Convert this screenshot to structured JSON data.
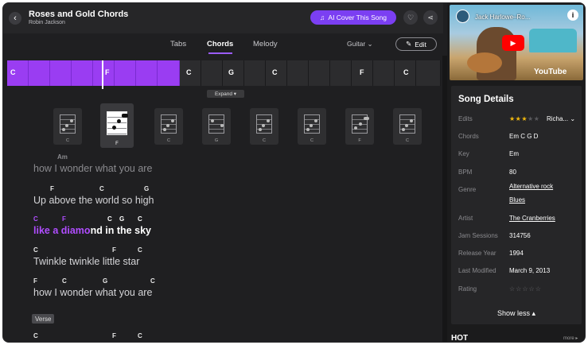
{
  "header": {
    "title": "Roses and Gold Chords",
    "artist": "Robin Jackson",
    "back_icon": "‹",
    "ai_cover_label": "AI Cover This Song",
    "ai_icon": "♫",
    "heart_icon": "♡",
    "share_icon": "⋖"
  },
  "tabs": {
    "tabs_label": "Tabs",
    "chords_label": "Chords",
    "melody_label": "Melody",
    "instrument": "Guitar",
    "instrument_caret": "⌄",
    "edit_label": "Edit",
    "edit_icon": "✎"
  },
  "timeline": {
    "chords": [
      "C",
      "F",
      "C",
      "G",
      "C",
      "F",
      "C"
    ],
    "expand_label": "Expand ▾"
  },
  "chord_diagrams": [
    "C",
    "F",
    "C",
    "G",
    "C",
    "C",
    "F",
    "C"
  ],
  "lyrics": [
    {
      "chords": [
        "Am"
      ],
      "text": "how I wonder what you are"
    },
    {
      "chords": [
        "F",
        "C",
        "G"
      ],
      "text": "Up above the world so high"
    },
    {
      "chords": [
        "C",
        "F",
        "C",
        "G",
        "C"
      ],
      "text_highlight": "like a diamo",
      "text_rest": "nd in the sky"
    },
    {
      "chords": [
        "C",
        "F",
        "C"
      ],
      "text": "Twinkle twinkle little star"
    },
    {
      "chords": [
        "F",
        "C",
        "G",
        "C"
      ],
      "text": "how I wonder what you are"
    },
    {
      "chords": [
        "C",
        "F",
        "C"
      ],
      "text": ""
    }
  ],
  "verse_tag": "Verse",
  "video": {
    "title": "Jack Harlowe–Ro...",
    "info_icon": "i",
    "play_icon": "▶",
    "logo": "YouTube"
  },
  "details": {
    "title": "Song Details",
    "edits_label": "Edits",
    "edits_value": "Richa...",
    "edits_caret": "⌄",
    "edits_rating": 3,
    "chords_label": "Chords",
    "chords_value": "Em C G D",
    "key_label": "Key",
    "key_value": "Em",
    "bpm_label": "BPM",
    "bpm_value": "80",
    "genre_label": "Genre",
    "genre_value_1": "Alternative rock",
    "genre_value_2": "Blues",
    "artist_label": "Artist",
    "artist_value": "The Cranberries",
    "jam_label": "Jam Sessions",
    "jam_value": "314756",
    "year_label": "Release Year",
    "year_value": "1994",
    "modified_label": "Last Modified",
    "modified_value": "March 9, 2013",
    "rating_label": "Rating",
    "rating_value": "☆☆☆☆☆",
    "show_less": "Show less ▴"
  },
  "hot": {
    "title": "HOT",
    "more": "more ▸"
  },
  "colors": {
    "accent": "#9a3df2",
    "highlight_text": "#b04dff",
    "star": "#f2b90d",
    "youtube_red": "#ff0000"
  }
}
